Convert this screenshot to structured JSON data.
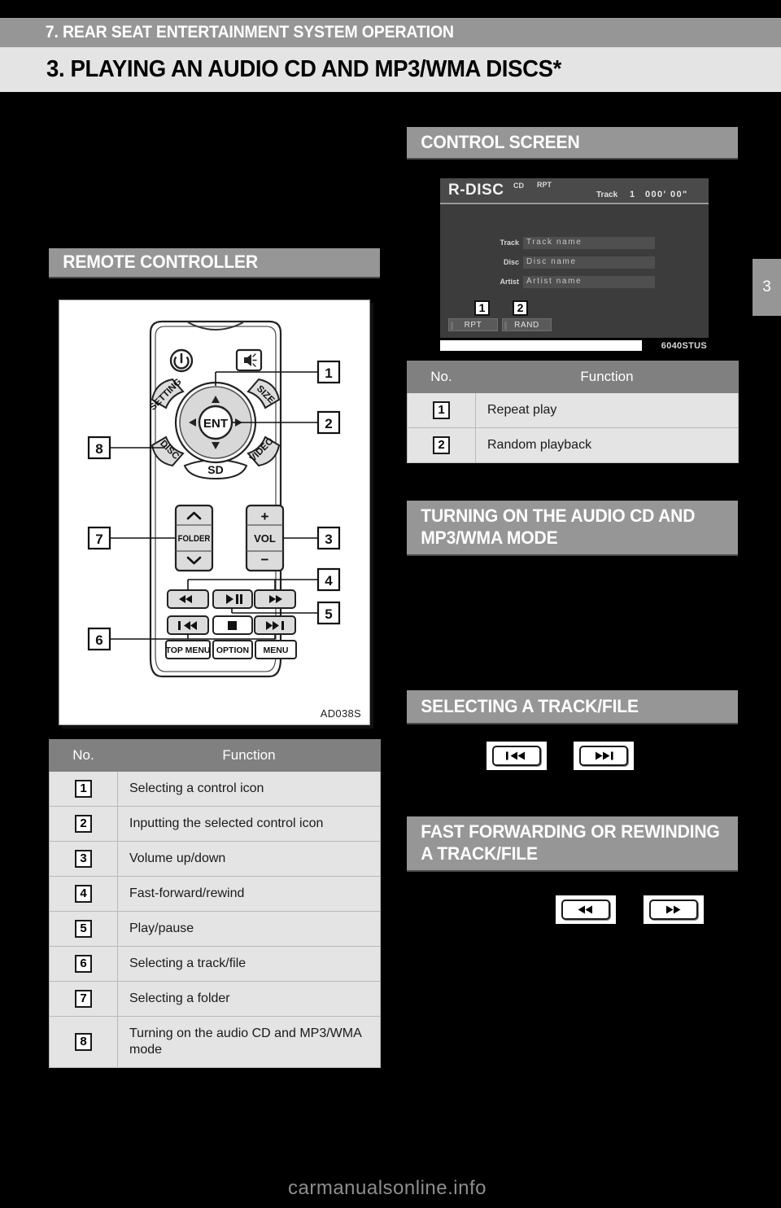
{
  "header": {
    "chapter": "7. REAR SEAT ENTERTAINMENT SYSTEM OPERATION",
    "title": "3. PLAYING AN AUDIO CD AND MP3/WMA DISCS*"
  },
  "side_tab": {
    "number": "3"
  },
  "left_column": {
    "section_heading": "REMOTE CONTROLLER",
    "figure": {
      "id_label": "AD038S"
    },
    "remote": {
      "power_icon": "power-icon",
      "mute_icon": "speaker-icon",
      "petals": [
        "SETTING",
        "SIZE",
        "DISC",
        "VIDEO",
        "SD"
      ],
      "enter_label": "ENT",
      "folder_label": "FOLDER",
      "volume_label": "VOL",
      "volume_plus": "+",
      "volume_minus": "−",
      "bottom_buttons": [
        "TOP MENU",
        "OPTION",
        "MENU"
      ],
      "callouts": [
        "1",
        "2",
        "3",
        "4",
        "5",
        "6",
        "7",
        "8"
      ]
    },
    "table": {
      "columns": [
        "No.",
        "Function"
      ],
      "rows": [
        {
          "no": "1",
          "function": "Selecting a control icon"
        },
        {
          "no": "2",
          "function": "Inputting the selected control icon"
        },
        {
          "no": "3",
          "function": "Volume up/down"
        },
        {
          "no": "4",
          "function": "Fast-forward/rewind"
        },
        {
          "no": "5",
          "function": "Play/pause"
        },
        {
          "no": "6",
          "function": "Selecting a track/file"
        },
        {
          "no": "7",
          "function": "Selecting a folder"
        },
        {
          "no": "8",
          "function": "Turning on the audio CD and MP3/WMA mode"
        }
      ]
    }
  },
  "right_column": {
    "control_screen": {
      "heading": "CONTROL SCREEN",
      "screen": {
        "source": "R-DISC",
        "media_type": "CD",
        "repeat_indicator": "RPT",
        "track_label": "Track",
        "track_number": "1",
        "elapsed_time": "000' 00\"",
        "fields": [
          {
            "label": "Track",
            "value": "Track name"
          },
          {
            "label": "Disc",
            "value": "Disc name"
          },
          {
            "label": "Artist",
            "value": "Artist name"
          }
        ],
        "buttons": [
          {
            "callout": "1",
            "label": "RPT"
          },
          {
            "callout": "2",
            "label": "RAND"
          }
        ],
        "figure_code": "6040STUS"
      },
      "table": {
        "columns": [
          "No.",
          "Function"
        ],
        "rows": [
          {
            "no": "1",
            "function": "Repeat play"
          },
          {
            "no": "2",
            "function": "Random playback"
          }
        ]
      }
    },
    "turning_on": {
      "heading": "TURNING ON THE AUDIO CD AND MP3/WMA MODE"
    },
    "selecting_track": {
      "heading": "SELECTING A TRACK/FILE",
      "keys": [
        "⏮",
        "⏭"
      ]
    },
    "fast_forward": {
      "heading": "FAST FORWARDING OR REWINDING A TRACK/FILE",
      "keys": [
        "◀◀",
        "▶▶"
      ]
    }
  },
  "footer": {
    "watermark": "carmanualsonline.info"
  }
}
